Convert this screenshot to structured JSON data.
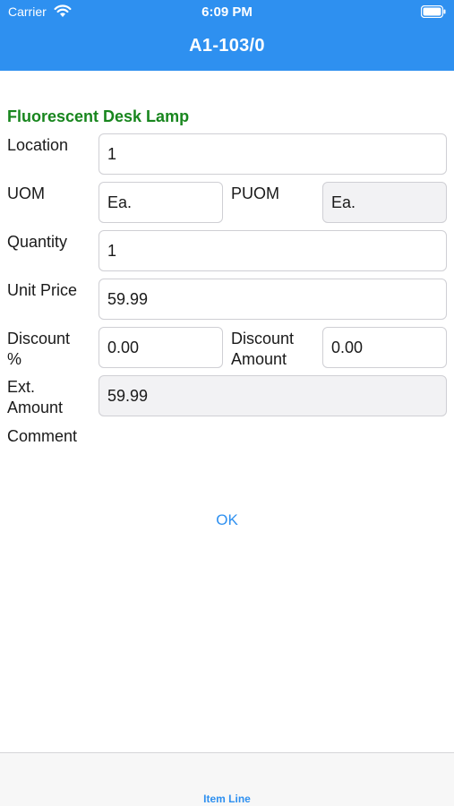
{
  "status_bar": {
    "carrier": "Carrier",
    "time": "6:09 PM",
    "wifi_icon": "wifi-icon",
    "battery_icon": "battery-icon"
  },
  "nav": {
    "title": "A1-103/0"
  },
  "item": {
    "name": "Fluorescent Desk Lamp"
  },
  "form": {
    "location_label": "Location",
    "location_value": "1",
    "uom_label": "UOM",
    "uom_value": "Ea.",
    "puom_label": "PUOM",
    "puom_value": "Ea.",
    "quantity_label": "Quantity",
    "quantity_value": "1",
    "unit_price_label": "Unit Price",
    "unit_price_value": "59.99",
    "discount_pct_label_line1": "Discount",
    "discount_pct_label_line2": "%",
    "discount_pct_value": "0.00",
    "discount_amt_label_line1": "Discount",
    "discount_amt_label_line2": "Amount",
    "discount_amt_value": "0.00",
    "ext_amount_label_line1": "Ext.",
    "ext_amount_label_line2": "Amount",
    "ext_amount_value": "59.99",
    "comment_label": "Comment"
  },
  "actions": {
    "ok_label": "OK"
  },
  "tab_bar": {
    "item_line_label": "Item Line"
  },
  "colors": {
    "header_bg": "#2e90f0",
    "title_green": "#18861e",
    "link_blue": "#2e90f0",
    "readonly_bg": "#f2f2f4"
  }
}
